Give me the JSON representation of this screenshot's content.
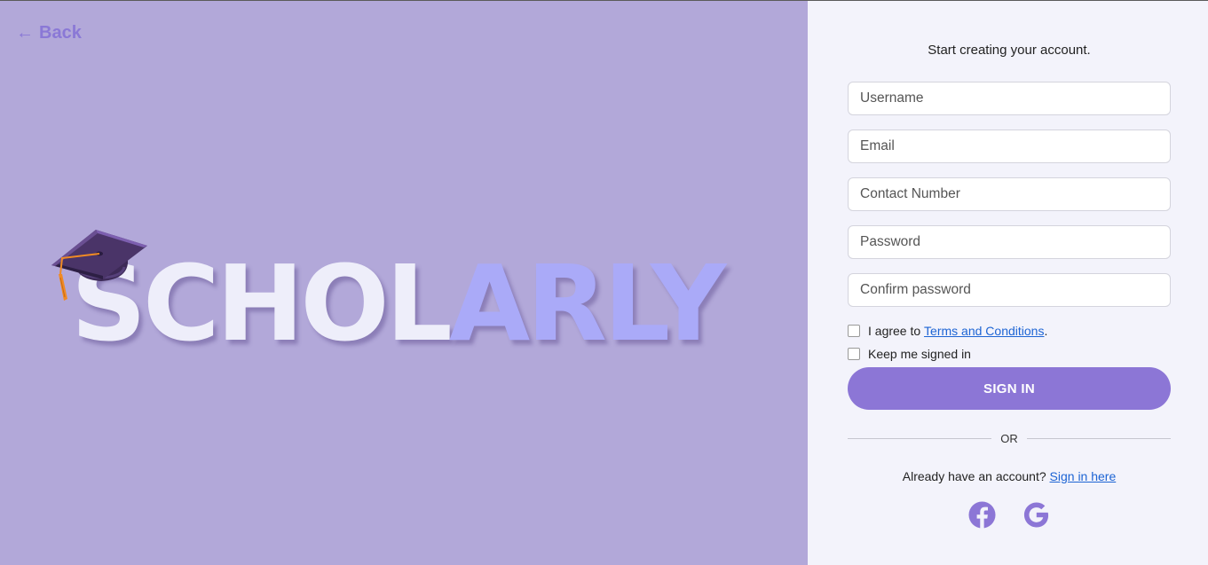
{
  "left_panel": {
    "back_label": "Back",
    "back_arrow": "←",
    "logo_part1": "SCHOL",
    "logo_part2": "ARLY"
  },
  "form": {
    "subtitle": "Start creating your account.",
    "username_placeholder": "Username",
    "email_placeholder": "Email",
    "contact_placeholder": "Contact Number",
    "password_placeholder": "Password",
    "confirm_placeholder": "Confirm password",
    "agree_prefix": "I agree to ",
    "terms_link": "Terms and Conditions",
    "agree_suffix": ".",
    "keep_signed_in": "Keep me signed in",
    "submit_label": "SIGN IN",
    "divider_label": "OR",
    "already_text": "Already have an account? ",
    "signin_link": "Sign in here"
  },
  "social": {
    "icons": [
      "facebook-icon",
      "google-icon"
    ]
  },
  "colors": {
    "left_bg": "#b2a8d9",
    "right_bg": "#f3f3fb",
    "accent": "#8c76d6",
    "logo_light": "#eeeefa",
    "logo_blue": "#aaaaf8",
    "link": "#1d64d4"
  }
}
